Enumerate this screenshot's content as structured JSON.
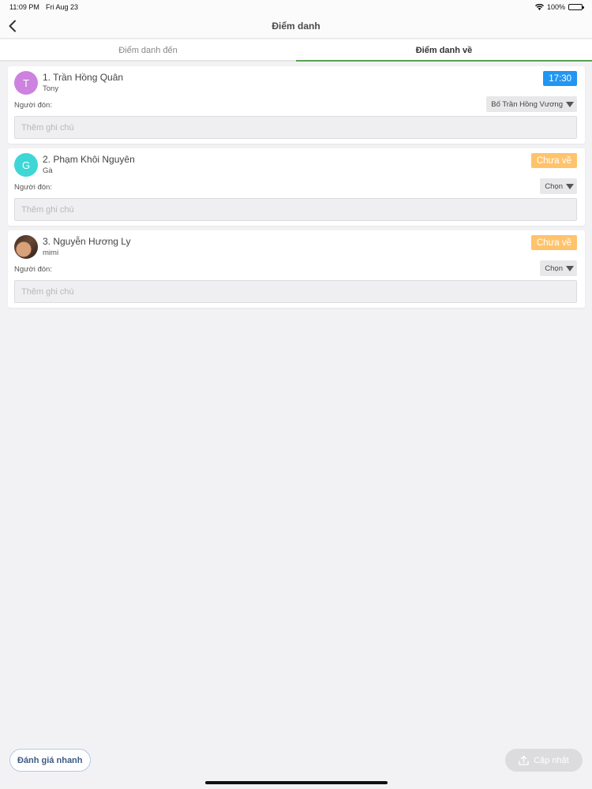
{
  "status_bar": {
    "time": "11:09 PM",
    "date": "Fri Aug 23",
    "battery": "100%"
  },
  "nav": {
    "title": "Điểm danh"
  },
  "tabs": [
    {
      "label": "Điểm danh đến",
      "active": false
    },
    {
      "label": "Điểm danh về",
      "active": true
    }
  ],
  "students": [
    {
      "name": "1. Trần Hồng Quân",
      "nickname": "Tony",
      "avatar_letter": "T",
      "avatar_color": "#cd82e0",
      "status": "17:30",
      "status_color": "#2196f3",
      "picker_label": "Người đón:",
      "picker_value": "Bố Trần Hồng Vương",
      "note_placeholder": "Thêm ghi chú",
      "note_value": ""
    },
    {
      "name": "2. Phạm Khôi Nguyên",
      "nickname": "Gà",
      "avatar_letter": "G",
      "avatar_color": "#3fd6d6",
      "status": "Chưa về",
      "status_color": "#ffc36b",
      "picker_label": "Người đón:",
      "picker_value": "Chọn",
      "note_placeholder": "Thêm ghi chú",
      "note_value": ""
    },
    {
      "name": "3. Nguyễn Hương Ly",
      "nickname": "mimi",
      "avatar_letter": "",
      "avatar_color": "#5a3d2e",
      "status": "Chưa về",
      "status_color": "#ffc36b",
      "picker_label": "Người đón:",
      "picker_value": "Chọn",
      "note_placeholder": "Thêm ghi chú",
      "note_value": ""
    }
  ],
  "footer": {
    "quick_eval_label": "Đánh giá nhanh",
    "update_label": "Cập nhật"
  }
}
